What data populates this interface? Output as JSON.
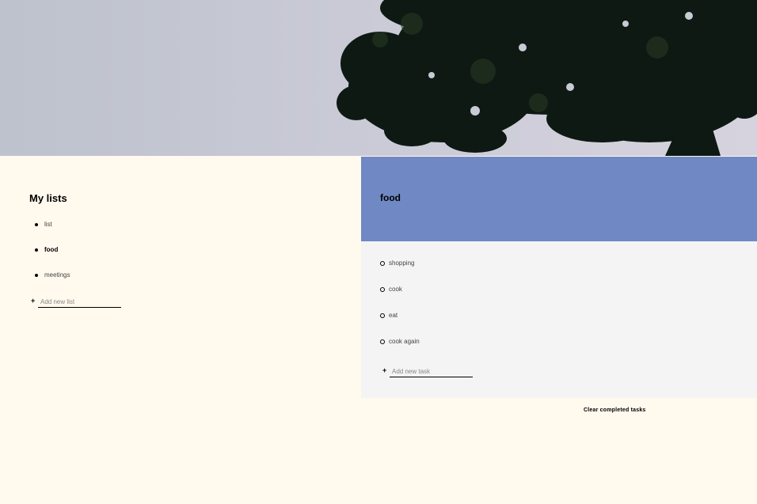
{
  "sidebar": {
    "title": "My lists",
    "items": [
      {
        "label": "list",
        "active": false
      },
      {
        "label": "food",
        "active": true
      },
      {
        "label": "meetings",
        "active": false
      }
    ],
    "add_icon": "+",
    "add_placeholder": "Add new list"
  },
  "main": {
    "title": "food",
    "header_color": "#7088c4",
    "tasks": [
      {
        "label": "shopping"
      },
      {
        "label": "cook"
      },
      {
        "label": "eat"
      },
      {
        "label": "cook again"
      }
    ],
    "add_icon": "+",
    "add_placeholder": "Add new task",
    "clear_label": "Clear completed tasks"
  },
  "colors": {
    "background": "#fff9ee",
    "task_panel": "#f4f4f4",
    "accent": "#7088c4"
  }
}
